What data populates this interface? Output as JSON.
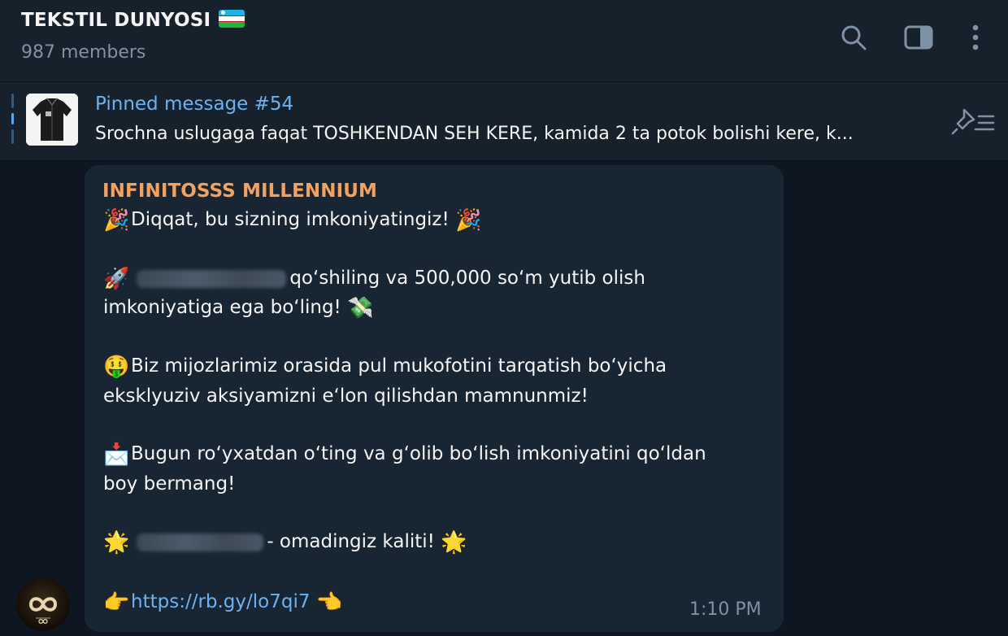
{
  "header": {
    "title": "TEKSTIL DUNYOSI",
    "members": "987 members",
    "icons": [
      "search-icon",
      "sidebar-toggle-icon",
      "more-vertical-icon"
    ]
  },
  "pinned": {
    "title": "Pinned message #54",
    "text": "Srochna uslugaga faqat TOSHKENDAN SEH KERE, kamida 2 ta potok bolishi kere, k..."
  },
  "message": {
    "sender": "INFINITOSSS MILLENNIUM",
    "line1": "Diqqat, bu sizning imkoniyatingiz!",
    "line2": "qo‘shiling va 500,000 so‘m yutib olish",
    "line3": "imkoniyatiga ega bo‘ling!",
    "line4": "Biz mijozlarimiz orasida pul mukofotini tarqatish bo‘yicha",
    "line5": "eksklyuziv aksiyamizni e‘lon qilishdan mamnunmiz!",
    "line6": "Bugun ro‘yxatdan o‘ting va g‘olib bo‘lish imkoniyatini qo‘ldan",
    "line7": "boy bermang!",
    "line8": "- omadingiz kaliti!",
    "link": "https://rb.gy/lo7qi7",
    "time": "1:10 PM",
    "emojis": {
      "party": "🎉",
      "rocket": "🚀",
      "money_wings": "💸",
      "money_face": "🤑",
      "envelope": "📩",
      "star": "🌟",
      "point_right": "👉",
      "point_left": "👈"
    }
  },
  "colors": {
    "background": "#0e1621",
    "header": "#17212b",
    "bubble": "#182533",
    "accent": "#6ab3f3",
    "sender": "#f5a15e",
    "muted": "#7f91a4"
  }
}
